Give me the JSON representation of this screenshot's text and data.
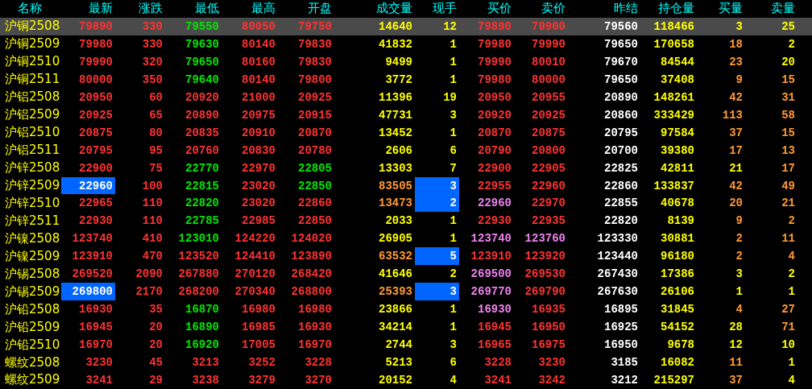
{
  "columns": [
    "名称",
    "最新",
    "涨跌",
    "最低",
    "最高",
    "开盘",
    "成交量",
    "现手",
    "买价",
    "卖价",
    "昨结",
    "持仓量",
    "买量",
    "卖量"
  ],
  "rows": [
    {
      "name": "沪铜2508",
      "selected": true,
      "cells": [
        {
          "v": "79890",
          "color": "#ff3232",
          "flash": false
        },
        {
          "v": "330",
          "color": "#ff3232",
          "flash": false
        },
        {
          "v": "79550",
          "color": "#00e600",
          "flash": false
        },
        {
          "v": "80050",
          "color": "#ff3232",
          "flash": false
        },
        {
          "v": "79750",
          "color": "#ff3232",
          "flash": false
        },
        {
          "v": "14640",
          "color": "#ffff00",
          "flash": false
        },
        {
          "v": "12",
          "color": "#ffff00",
          "flash": false
        },
        {
          "v": "79890",
          "color": "#ff3232",
          "flash": false
        },
        {
          "v": "79900",
          "color": "#ff3232",
          "flash": false
        },
        {
          "v": "79560",
          "color": "#ffffff",
          "flash": false
        },
        {
          "v": "118466",
          "color": "#ffff00",
          "flash": false
        },
        {
          "v": "3",
          "color": "#ffff00",
          "flash": false
        },
        {
          "v": "25",
          "color": "#ffff00",
          "flash": false
        }
      ]
    },
    {
      "name": "沪铜2509",
      "selected": false,
      "cells": [
        {
          "v": "79980",
          "color": "#ff3232",
          "flash": false
        },
        {
          "v": "330",
          "color": "#ff3232",
          "flash": false
        },
        {
          "v": "79630",
          "color": "#00e600",
          "flash": false
        },
        {
          "v": "80140",
          "color": "#ff3232",
          "flash": false
        },
        {
          "v": "79830",
          "color": "#ff3232",
          "flash": false
        },
        {
          "v": "41832",
          "color": "#ffff00",
          "flash": false
        },
        {
          "v": "1",
          "color": "#ffff00",
          "flash": false
        },
        {
          "v": "79980",
          "color": "#ff3232",
          "flash": false
        },
        {
          "v": "79990",
          "color": "#ff3232",
          "flash": false
        },
        {
          "v": "79650",
          "color": "#ffffff",
          "flash": false
        },
        {
          "v": "170658",
          "color": "#ffff00",
          "flash": false
        },
        {
          "v": "18",
          "color": "#ff9933",
          "flash": false
        },
        {
          "v": "2",
          "color": "#ffff00",
          "flash": false
        }
      ]
    },
    {
      "name": "沪铜2510",
      "selected": false,
      "cells": [
        {
          "v": "79990",
          "color": "#ff3232",
          "flash": false
        },
        {
          "v": "320",
          "color": "#ff3232",
          "flash": false
        },
        {
          "v": "79650",
          "color": "#00e600",
          "flash": false
        },
        {
          "v": "80160",
          "color": "#ff3232",
          "flash": false
        },
        {
          "v": "79830",
          "color": "#ff3232",
          "flash": false
        },
        {
          "v": "9499",
          "color": "#ffff00",
          "flash": false
        },
        {
          "v": "1",
          "color": "#ffff00",
          "flash": false
        },
        {
          "v": "79990",
          "color": "#ff3232",
          "flash": false
        },
        {
          "v": "80010",
          "color": "#ff3232",
          "flash": false
        },
        {
          "v": "79670",
          "color": "#ffffff",
          "flash": false
        },
        {
          "v": "84544",
          "color": "#ffff00",
          "flash": false
        },
        {
          "v": "23",
          "color": "#ff9933",
          "flash": false
        },
        {
          "v": "20",
          "color": "#ffff00",
          "flash": false
        }
      ]
    },
    {
      "name": "沪铜2511",
      "selected": false,
      "cells": [
        {
          "v": "80000",
          "color": "#ff3232",
          "flash": false
        },
        {
          "v": "350",
          "color": "#ff3232",
          "flash": false
        },
        {
          "v": "79640",
          "color": "#00e600",
          "flash": false
        },
        {
          "v": "80140",
          "color": "#ff3232",
          "flash": false
        },
        {
          "v": "79800",
          "color": "#ff3232",
          "flash": false
        },
        {
          "v": "3772",
          "color": "#ffff00",
          "flash": false
        },
        {
          "v": "1",
          "color": "#ffff00",
          "flash": false
        },
        {
          "v": "79980",
          "color": "#ff3232",
          "flash": false
        },
        {
          "v": "80000",
          "color": "#ff3232",
          "flash": false
        },
        {
          "v": "79650",
          "color": "#ffffff",
          "flash": false
        },
        {
          "v": "37408",
          "color": "#ffff00",
          "flash": false
        },
        {
          "v": "9",
          "color": "#ff9933",
          "flash": false
        },
        {
          "v": "15",
          "color": "#ff9933",
          "flash": false
        }
      ]
    },
    {
      "name": "沪铝2508",
      "selected": false,
      "cells": [
        {
          "v": "20950",
          "color": "#ff3232",
          "flash": false
        },
        {
          "v": "60",
          "color": "#ff3232",
          "flash": false
        },
        {
          "v": "20920",
          "color": "#ff3232",
          "flash": false
        },
        {
          "v": "21000",
          "color": "#ff3232",
          "flash": false
        },
        {
          "v": "20925",
          "color": "#ff3232",
          "flash": false
        },
        {
          "v": "11396",
          "color": "#ffff00",
          "flash": false
        },
        {
          "v": "19",
          "color": "#ffff00",
          "flash": false
        },
        {
          "v": "20950",
          "color": "#ff3232",
          "flash": false
        },
        {
          "v": "20955",
          "color": "#ff3232",
          "flash": false
        },
        {
          "v": "20890",
          "color": "#ffffff",
          "flash": false
        },
        {
          "v": "148261",
          "color": "#ffff00",
          "flash": false
        },
        {
          "v": "42",
          "color": "#ff9933",
          "flash": false
        },
        {
          "v": "31",
          "color": "#ff9933",
          "flash": false
        }
      ]
    },
    {
      "name": "沪铝2509",
      "selected": false,
      "cells": [
        {
          "v": "20925",
          "color": "#ff3232",
          "flash": false
        },
        {
          "v": "65",
          "color": "#ff3232",
          "flash": false
        },
        {
          "v": "20890",
          "color": "#ff3232",
          "flash": false
        },
        {
          "v": "20975",
          "color": "#ff3232",
          "flash": false
        },
        {
          "v": "20915",
          "color": "#ff3232",
          "flash": false
        },
        {
          "v": "47731",
          "color": "#ffff00",
          "flash": false
        },
        {
          "v": "3",
          "color": "#ffff00",
          "flash": false
        },
        {
          "v": "20920",
          "color": "#ff3232",
          "flash": false
        },
        {
          "v": "20925",
          "color": "#ff3232",
          "flash": false
        },
        {
          "v": "20860",
          "color": "#ffffff",
          "flash": false
        },
        {
          "v": "333429",
          "color": "#ffff00",
          "flash": false
        },
        {
          "v": "113",
          "color": "#ff9933",
          "flash": false
        },
        {
          "v": "58",
          "color": "#ff9933",
          "flash": false
        }
      ]
    },
    {
      "name": "沪铝2510",
      "selected": false,
      "cells": [
        {
          "v": "20875",
          "color": "#ff3232",
          "flash": false
        },
        {
          "v": "80",
          "color": "#ff3232",
          "flash": false
        },
        {
          "v": "20835",
          "color": "#ff3232",
          "flash": false
        },
        {
          "v": "20910",
          "color": "#ff3232",
          "flash": false
        },
        {
          "v": "20870",
          "color": "#ff3232",
          "flash": false
        },
        {
          "v": "13452",
          "color": "#ffff00",
          "flash": false
        },
        {
          "v": "1",
          "color": "#ffff00",
          "flash": false
        },
        {
          "v": "20870",
          "color": "#ff3232",
          "flash": false
        },
        {
          "v": "20875",
          "color": "#ff3232",
          "flash": false
        },
        {
          "v": "20795",
          "color": "#ffffff",
          "flash": false
        },
        {
          "v": "97584",
          "color": "#ffff00",
          "flash": false
        },
        {
          "v": "37",
          "color": "#ff9933",
          "flash": false
        },
        {
          "v": "15",
          "color": "#ff9933",
          "flash": false
        }
      ]
    },
    {
      "name": "沪铝2511",
      "selected": false,
      "cells": [
        {
          "v": "20795",
          "color": "#ff3232",
          "flash": false
        },
        {
          "v": "95",
          "color": "#ff3232",
          "flash": false
        },
        {
          "v": "20760",
          "color": "#ff3232",
          "flash": false
        },
        {
          "v": "20830",
          "color": "#ff3232",
          "flash": false
        },
        {
          "v": "20780",
          "color": "#ff3232",
          "flash": false
        },
        {
          "v": "2606",
          "color": "#ffff00",
          "flash": false
        },
        {
          "v": "6",
          "color": "#ffff00",
          "flash": false
        },
        {
          "v": "20790",
          "color": "#ff3232",
          "flash": false
        },
        {
          "v": "20800",
          "color": "#ff3232",
          "flash": false
        },
        {
          "v": "20700",
          "color": "#ffffff",
          "flash": false
        },
        {
          "v": "39380",
          "color": "#ffff00",
          "flash": false
        },
        {
          "v": "17",
          "color": "#ff9933",
          "flash": false
        },
        {
          "v": "13",
          "color": "#ff9933",
          "flash": false
        }
      ]
    },
    {
      "name": "沪锌2508",
      "selected": false,
      "cells": [
        {
          "v": "22900",
          "color": "#ff3232",
          "flash": false
        },
        {
          "v": "75",
          "color": "#ff3232",
          "flash": false
        },
        {
          "v": "22770",
          "color": "#00e600",
          "flash": false
        },
        {
          "v": "22970",
          "color": "#ff3232",
          "flash": false
        },
        {
          "v": "22805",
          "color": "#00e600",
          "flash": false
        },
        {
          "v": "13303",
          "color": "#ffff00",
          "flash": false
        },
        {
          "v": "7",
          "color": "#ffff00",
          "flash": false
        },
        {
          "v": "22900",
          "color": "#ff3232",
          "flash": false
        },
        {
          "v": "22905",
          "color": "#ff3232",
          "flash": false
        },
        {
          "v": "22825",
          "color": "#ffffff",
          "flash": false
        },
        {
          "v": "42811",
          "color": "#ffff00",
          "flash": false
        },
        {
          "v": "21",
          "color": "#ffff00",
          "flash": false
        },
        {
          "v": "17",
          "color": "#ff9933",
          "flash": false
        }
      ]
    },
    {
      "name": "沪锌2509",
      "selected": false,
      "cells": [
        {
          "v": "22960",
          "color": "#ffffff",
          "flash": true
        },
        {
          "v": "100",
          "color": "#ff3232",
          "flash": false
        },
        {
          "v": "22815",
          "color": "#00e600",
          "flash": false
        },
        {
          "v": "23020",
          "color": "#ff3232",
          "flash": false
        },
        {
          "v": "22850",
          "color": "#00e600",
          "flash": false
        },
        {
          "v": "83505",
          "color": "#ff9933",
          "flash": false
        },
        {
          "v": "3",
          "color": "#ffffff",
          "flash": true
        },
        {
          "v": "22955",
          "color": "#ff3232",
          "flash": false
        },
        {
          "v": "22960",
          "color": "#ff3232",
          "flash": false
        },
        {
          "v": "22860",
          "color": "#ffffff",
          "flash": false
        },
        {
          "v": "133837",
          "color": "#ffff00",
          "flash": false
        },
        {
          "v": "42",
          "color": "#ff9933",
          "flash": false
        },
        {
          "v": "49",
          "color": "#ff9933",
          "flash": false
        }
      ]
    },
    {
      "name": "沪锌2510",
      "selected": false,
      "cells": [
        {
          "v": "22965",
          "color": "#ff3232",
          "flash": false
        },
        {
          "v": "110",
          "color": "#ff3232",
          "flash": false
        },
        {
          "v": "22820",
          "color": "#00e600",
          "flash": false
        },
        {
          "v": "23020",
          "color": "#ff3232",
          "flash": false
        },
        {
          "v": "22860",
          "color": "#ff3232",
          "flash": false
        },
        {
          "v": "13473",
          "color": "#ff9933",
          "flash": false
        },
        {
          "v": "2",
          "color": "#ffffff",
          "flash": true
        },
        {
          "v": "22960",
          "color": "#ee82ee",
          "flash": false
        },
        {
          "v": "22970",
          "color": "#ff3232",
          "flash": false
        },
        {
          "v": "22855",
          "color": "#ffffff",
          "flash": false
        },
        {
          "v": "40678",
          "color": "#ffff00",
          "flash": false
        },
        {
          "v": "20",
          "color": "#ff9933",
          "flash": false
        },
        {
          "v": "21",
          "color": "#ff9933",
          "flash": false
        }
      ]
    },
    {
      "name": "沪锌2511",
      "selected": false,
      "cells": [
        {
          "v": "22930",
          "color": "#ff3232",
          "flash": false
        },
        {
          "v": "110",
          "color": "#ff3232",
          "flash": false
        },
        {
          "v": "22785",
          "color": "#00e600",
          "flash": false
        },
        {
          "v": "22985",
          "color": "#ff3232",
          "flash": false
        },
        {
          "v": "22850",
          "color": "#ff3232",
          "flash": false
        },
        {
          "v": "2033",
          "color": "#ffff00",
          "flash": false
        },
        {
          "v": "1",
          "color": "#ffff00",
          "flash": false
        },
        {
          "v": "22930",
          "color": "#ff3232",
          "flash": false
        },
        {
          "v": "22935",
          "color": "#ff3232",
          "flash": false
        },
        {
          "v": "22820",
          "color": "#ffffff",
          "flash": false
        },
        {
          "v": "8139",
          "color": "#ffff00",
          "flash": false
        },
        {
          "v": "9",
          "color": "#ff9933",
          "flash": false
        },
        {
          "v": "2",
          "color": "#ff9933",
          "flash": false
        }
      ]
    },
    {
      "name": "沪镍2508",
      "selected": false,
      "cells": [
        {
          "v": "123740",
          "color": "#ff3232",
          "flash": false
        },
        {
          "v": "410",
          "color": "#ff3232",
          "flash": false
        },
        {
          "v": "123010",
          "color": "#00e600",
          "flash": false
        },
        {
          "v": "124220",
          "color": "#ff3232",
          "flash": false
        },
        {
          "v": "124020",
          "color": "#ff3232",
          "flash": false
        },
        {
          "v": "26905",
          "color": "#ffff00",
          "flash": false
        },
        {
          "v": "1",
          "color": "#ffff00",
          "flash": false
        },
        {
          "v": "123740",
          "color": "#ee82ee",
          "flash": false
        },
        {
          "v": "123760",
          "color": "#ee82ee",
          "flash": false
        },
        {
          "v": "123330",
          "color": "#ffffff",
          "flash": false
        },
        {
          "v": "30881",
          "color": "#ffff00",
          "flash": false
        },
        {
          "v": "2",
          "color": "#ff9933",
          "flash": false
        },
        {
          "v": "11",
          "color": "#ff9933",
          "flash": false
        }
      ]
    },
    {
      "name": "沪镍2509",
      "selected": false,
      "cells": [
        {
          "v": "123910",
          "color": "#ff3232",
          "flash": false
        },
        {
          "v": "470",
          "color": "#ff3232",
          "flash": false
        },
        {
          "v": "123520",
          "color": "#ff3232",
          "flash": false
        },
        {
          "v": "124410",
          "color": "#ff3232",
          "flash": false
        },
        {
          "v": "123890",
          "color": "#ff3232",
          "flash": false
        },
        {
          "v": "63532",
          "color": "#ff9933",
          "flash": false
        },
        {
          "v": "5",
          "color": "#ffffff",
          "flash": true
        },
        {
          "v": "123910",
          "color": "#ff3232",
          "flash": false
        },
        {
          "v": "123920",
          "color": "#ff3232",
          "flash": false
        },
        {
          "v": "123440",
          "color": "#ffffff",
          "flash": false
        },
        {
          "v": "96180",
          "color": "#ffff00",
          "flash": false
        },
        {
          "v": "2",
          "color": "#ff9933",
          "flash": false
        },
        {
          "v": "4",
          "color": "#ff9933",
          "flash": false
        }
      ]
    },
    {
      "name": "沪锡2508",
      "selected": false,
      "cells": [
        {
          "v": "269520",
          "color": "#ff3232",
          "flash": false
        },
        {
          "v": "2090",
          "color": "#ff3232",
          "flash": false
        },
        {
          "v": "267880",
          "color": "#ff3232",
          "flash": false
        },
        {
          "v": "270120",
          "color": "#ff3232",
          "flash": false
        },
        {
          "v": "268420",
          "color": "#ff3232",
          "flash": false
        },
        {
          "v": "41646",
          "color": "#ffff00",
          "flash": false
        },
        {
          "v": "2",
          "color": "#ffff00",
          "flash": false
        },
        {
          "v": "269500",
          "color": "#ee82ee",
          "flash": false
        },
        {
          "v": "269530",
          "color": "#ff3232",
          "flash": false
        },
        {
          "v": "267430",
          "color": "#ffffff",
          "flash": false
        },
        {
          "v": "17386",
          "color": "#ffff00",
          "flash": false
        },
        {
          "v": "3",
          "color": "#ffff00",
          "flash": false
        },
        {
          "v": "2",
          "color": "#ffff00",
          "flash": false
        }
      ]
    },
    {
      "name": "沪锡2509",
      "selected": false,
      "cells": [
        {
          "v": "269800",
          "color": "#ffffff",
          "flash": true
        },
        {
          "v": "2170",
          "color": "#ff3232",
          "flash": false
        },
        {
          "v": "268200",
          "color": "#ff3232",
          "flash": false
        },
        {
          "v": "270340",
          "color": "#ff3232",
          "flash": false
        },
        {
          "v": "268800",
          "color": "#ff3232",
          "flash": false
        },
        {
          "v": "25393",
          "color": "#ff9933",
          "flash": false
        },
        {
          "v": "3",
          "color": "#ffffff",
          "flash": true
        },
        {
          "v": "269770",
          "color": "#ee82ee",
          "flash": false
        },
        {
          "v": "269790",
          "color": "#ff3232",
          "flash": false
        },
        {
          "v": "267630",
          "color": "#ffffff",
          "flash": false
        },
        {
          "v": "26106",
          "color": "#ffff00",
          "flash": false
        },
        {
          "v": "1",
          "color": "#ffff00",
          "flash": false
        },
        {
          "v": "1",
          "color": "#ffff00",
          "flash": false
        }
      ]
    },
    {
      "name": "沪铅2508",
      "selected": false,
      "cells": [
        {
          "v": "16930",
          "color": "#ff3232",
          "flash": false
        },
        {
          "v": "35",
          "color": "#ff3232",
          "flash": false
        },
        {
          "v": "16870",
          "color": "#00e600",
          "flash": false
        },
        {
          "v": "16980",
          "color": "#ff3232",
          "flash": false
        },
        {
          "v": "16980",
          "color": "#ff3232",
          "flash": false
        },
        {
          "v": "23866",
          "color": "#ffff00",
          "flash": false
        },
        {
          "v": "1",
          "color": "#ffff00",
          "flash": false
        },
        {
          "v": "16930",
          "color": "#ee82ee",
          "flash": false
        },
        {
          "v": "16935",
          "color": "#ff3232",
          "flash": false
        },
        {
          "v": "16895",
          "color": "#ffffff",
          "flash": false
        },
        {
          "v": "31845",
          "color": "#ffff00",
          "flash": false
        },
        {
          "v": "4",
          "color": "#ff9933",
          "flash": false
        },
        {
          "v": "27",
          "color": "#ff9933",
          "flash": false
        }
      ]
    },
    {
      "name": "沪铅2509",
      "selected": false,
      "cells": [
        {
          "v": "16945",
          "color": "#ff3232",
          "flash": false
        },
        {
          "v": "20",
          "color": "#ff3232",
          "flash": false
        },
        {
          "v": "16890",
          "color": "#00e600",
          "flash": false
        },
        {
          "v": "16985",
          "color": "#ff3232",
          "flash": false
        },
        {
          "v": "16930",
          "color": "#ff3232",
          "flash": false
        },
        {
          "v": "34214",
          "color": "#ffff00",
          "flash": false
        },
        {
          "v": "1",
          "color": "#ffff00",
          "flash": false
        },
        {
          "v": "16945",
          "color": "#ff3232",
          "flash": false
        },
        {
          "v": "16950",
          "color": "#ff3232",
          "flash": false
        },
        {
          "v": "16925",
          "color": "#ffffff",
          "flash": false
        },
        {
          "v": "54152",
          "color": "#ffff00",
          "flash": false
        },
        {
          "v": "28",
          "color": "#ffff00",
          "flash": false
        },
        {
          "v": "71",
          "color": "#ff9933",
          "flash": false
        }
      ]
    },
    {
      "name": "沪铅2510",
      "selected": false,
      "cells": [
        {
          "v": "16970",
          "color": "#ff3232",
          "flash": false
        },
        {
          "v": "20",
          "color": "#ff3232",
          "flash": false
        },
        {
          "v": "16920",
          "color": "#00e600",
          "flash": false
        },
        {
          "v": "17005",
          "color": "#ff3232",
          "flash": false
        },
        {
          "v": "16970",
          "color": "#ff3232",
          "flash": false
        },
        {
          "v": "2744",
          "color": "#ffff00",
          "flash": false
        },
        {
          "v": "3",
          "color": "#ffff00",
          "flash": false
        },
        {
          "v": "16965",
          "color": "#ff3232",
          "flash": false
        },
        {
          "v": "16975",
          "color": "#ff3232",
          "flash": false
        },
        {
          "v": "16950",
          "color": "#ffffff",
          "flash": false
        },
        {
          "v": "9678",
          "color": "#ffff00",
          "flash": false
        },
        {
          "v": "12",
          "color": "#ffff00",
          "flash": false
        },
        {
          "v": "10",
          "color": "#ffff00",
          "flash": false
        }
      ]
    },
    {
      "name": "螺纹2508",
      "selected": false,
      "cells": [
        {
          "v": "3230",
          "color": "#ff3232",
          "flash": false
        },
        {
          "v": "45",
          "color": "#ff3232",
          "flash": false
        },
        {
          "v": "3213",
          "color": "#ff3232",
          "flash": false
        },
        {
          "v": "3252",
          "color": "#ff3232",
          "flash": false
        },
        {
          "v": "3228",
          "color": "#ff3232",
          "flash": false
        },
        {
          "v": "5213",
          "color": "#ffff00",
          "flash": false
        },
        {
          "v": "6",
          "color": "#ffff00",
          "flash": false
        },
        {
          "v": "3228",
          "color": "#ff3232",
          "flash": false
        },
        {
          "v": "3230",
          "color": "#ff3232",
          "flash": false
        },
        {
          "v": "3185",
          "color": "#ffffff",
          "flash": false
        },
        {
          "v": "16082",
          "color": "#ffff00",
          "flash": false
        },
        {
          "v": "11",
          "color": "#ff9933",
          "flash": false
        },
        {
          "v": "1",
          "color": "#ffff00",
          "flash": false
        }
      ]
    },
    {
      "name": "螺纹2509",
      "selected": false,
      "cells": [
        {
          "v": "3241",
          "color": "#ff3232",
          "flash": false
        },
        {
          "v": "29",
          "color": "#ff3232",
          "flash": false
        },
        {
          "v": "3238",
          "color": "#ff3232",
          "flash": false
        },
        {
          "v": "3279",
          "color": "#ff3232",
          "flash": false
        },
        {
          "v": "3270",
          "color": "#ff3232",
          "flash": false
        },
        {
          "v": "20152",
          "color": "#ffff00",
          "flash": false
        },
        {
          "v": "4",
          "color": "#ffff00",
          "flash": false
        },
        {
          "v": "3241",
          "color": "#ff3232",
          "flash": false
        },
        {
          "v": "3242",
          "color": "#ff3232",
          "flash": false
        },
        {
          "v": "3212",
          "color": "#ffffff",
          "flash": false
        },
        {
          "v": "215297",
          "color": "#ffff00",
          "flash": false
        },
        {
          "v": "37",
          "color": "#ff9933",
          "flash": false
        },
        {
          "v": "4",
          "color": "#ffff00",
          "flash": false
        }
      ]
    }
  ]
}
